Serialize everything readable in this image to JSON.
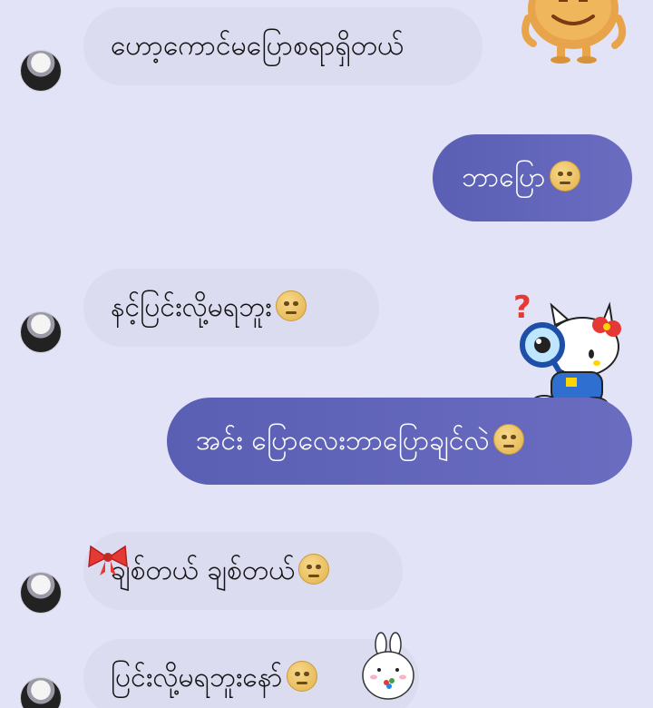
{
  "messages": [
    {
      "side": "in",
      "text": "ဟော့ကောင်မပြောစရာရှိတယ်",
      "emoji": ""
    },
    {
      "side": "out",
      "text": "ဘာပြော",
      "emoji": "rolling-eyes-emoji"
    },
    {
      "side": "in",
      "text": "နင့်ပြင်းလို့မရဘူး",
      "emoji": "expressionless-emoji"
    },
    {
      "side": "out",
      "text": "အင်း ပြောလေးဘာပြောချင်လဲ",
      "emoji": "unamused-emoji"
    },
    {
      "side": "in",
      "text": "ချစ်တယ် ချစ်တယ်",
      "emoji": "rolling-eyes-emoji"
    },
    {
      "side": "in",
      "text": "ပြင်းလို့မရဘူးနော်",
      "emoji": "expressionless-emoji"
    }
  ],
  "stickers": {
    "top": "cartoon-potato-sticker",
    "middle": "hello-kitty-magnifier-sticker",
    "bow": "red-bow-sticker",
    "bottom": "white-bunny-sticker"
  },
  "colors": {
    "background": "#e3e3f7",
    "incoming_bubble": "#dcdcf0",
    "outgoing_bubble": "#5a5fb4"
  }
}
